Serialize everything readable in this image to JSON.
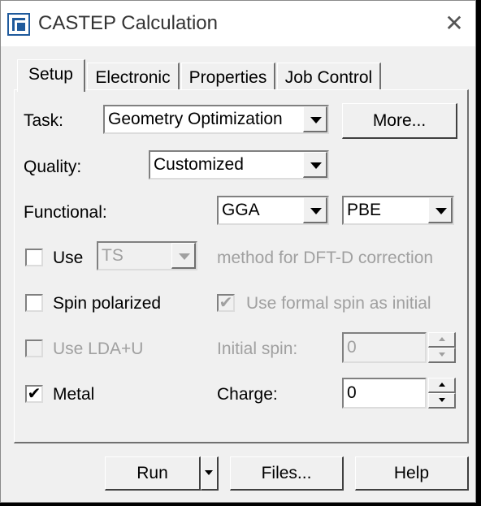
{
  "window": {
    "title": "CASTEP Calculation",
    "close_glyph": "✕"
  },
  "tabs": [
    {
      "label": "Setup",
      "active": true
    },
    {
      "label": "Electronic",
      "active": false
    },
    {
      "label": "Properties",
      "active": false
    },
    {
      "label": "Job Control",
      "active": false
    }
  ],
  "setup": {
    "task_label": "Task:",
    "task_value": "Geometry Optimization",
    "more_label": "More...",
    "quality_label": "Quality:",
    "quality_value": "Customized",
    "functional_label": "Functional:",
    "functional_value": "GGA",
    "functional_variant": "PBE",
    "use_label": "Use",
    "dftd_method": "TS",
    "dftd_suffix": "method for DFT-D correction",
    "spin_polarized_label": "Spin polarized",
    "formal_spin_label": "Use formal spin as initial",
    "lda_u_label": "Use LDA+U",
    "initial_spin_label": "Initial spin:",
    "initial_spin_value": "0",
    "metal_label": "Metal",
    "charge_label": "Charge:",
    "charge_value": "0",
    "checks": {
      "use_dftd": false,
      "spin_polarized": false,
      "formal_spin": true,
      "lda_u": false,
      "metal": true
    }
  },
  "buttons": {
    "run": "Run",
    "files": "Files...",
    "help": "Help"
  },
  "check_glyph": "✔"
}
